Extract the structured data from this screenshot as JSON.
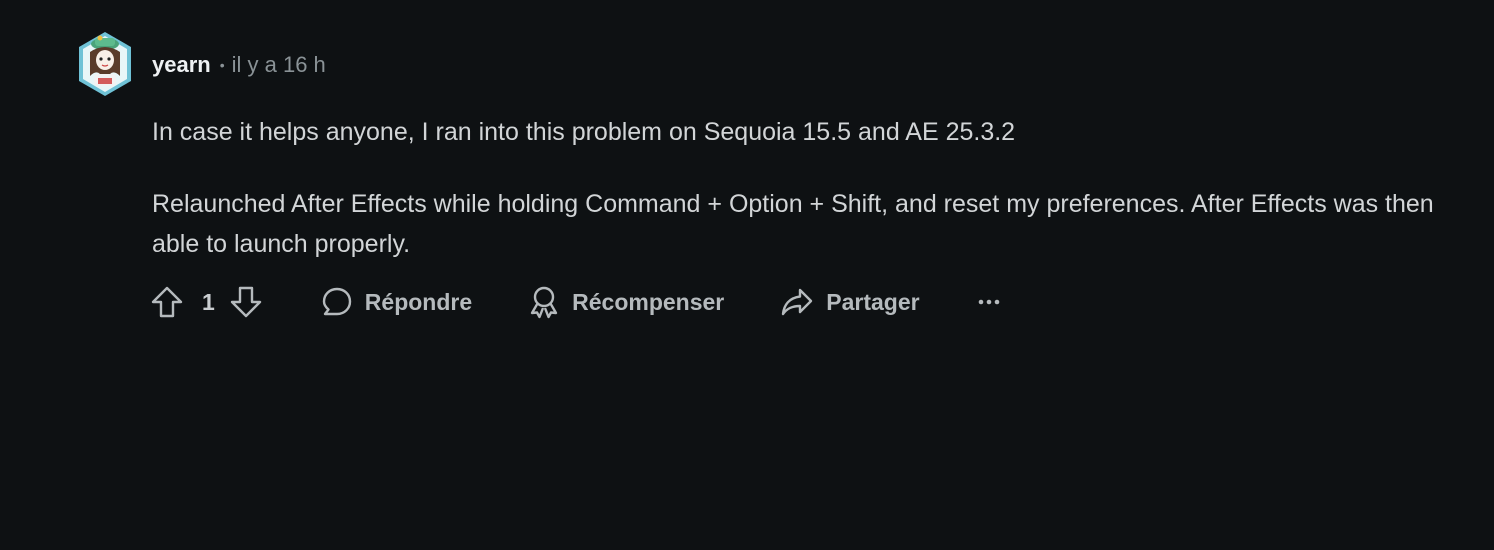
{
  "comment": {
    "author": "yearn",
    "separator": "•",
    "time": "il y a 16 h",
    "paragraphs": [
      "In case it helps anyone, I ran into this problem on Sequoia 15.5 and AE 25.3.2",
      "Relaunched After Effects while holding Command + Option + Shift, and reset my preferences. After Effects was then able to launch properly."
    ],
    "votes": "1"
  },
  "actions": {
    "upvote_icon": "upvote-arrow-icon",
    "downvote_icon": "downvote-arrow-icon",
    "reply": {
      "label": "Répondre",
      "icon": "speech-bubble-icon"
    },
    "award": {
      "label": "Récompenser",
      "icon": "award-ribbon-icon"
    },
    "share": {
      "label": "Partager",
      "icon": "share-arrow-icon"
    },
    "more": {
      "label": "•••",
      "icon": "more-horizontal-icon"
    }
  },
  "colors": {
    "background": "#0e1113",
    "text": "#d2d5d7",
    "muted": "#8a9296",
    "avatar_frame": "#6fc2d6"
  }
}
